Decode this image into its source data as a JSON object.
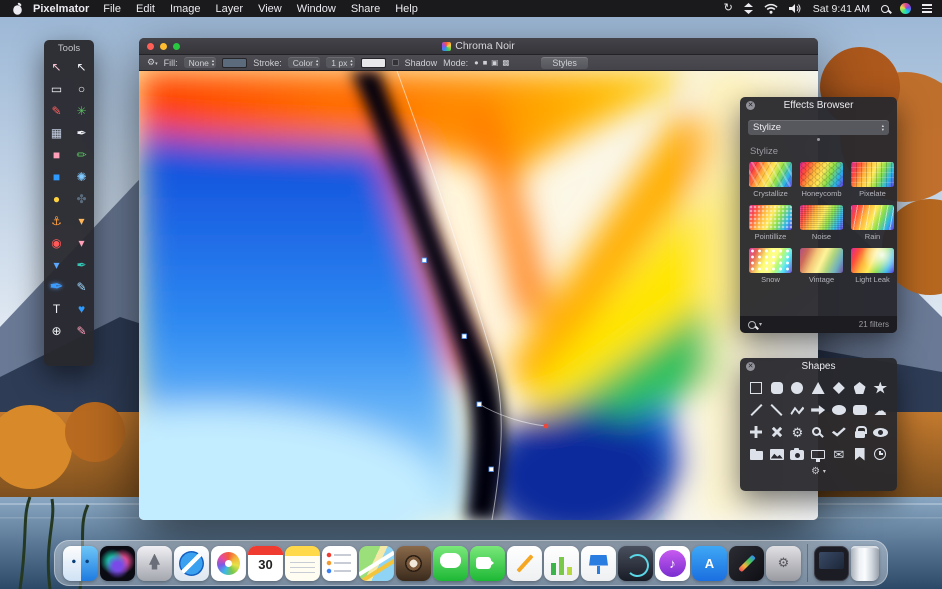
{
  "menu_bar": {
    "app_name": "Pixelmator",
    "menus": [
      "File",
      "Edit",
      "Image",
      "Layer",
      "View",
      "Window",
      "Share",
      "Help"
    ],
    "clock": "Sat 9:41 AM"
  },
  "tools_panel": {
    "title": "Tools",
    "selected_index": 20,
    "tools": [
      {
        "name": "move-tool",
        "glyph": "↖",
        "color": "#f6c3d0"
      },
      {
        "name": "pointer-tool",
        "glyph": "↖",
        "color": "#eef1f6"
      },
      {
        "name": "rect-marquee-tool",
        "glyph": "▭",
        "color": "#eef1f6"
      },
      {
        "name": "ellipse-marquee-tool",
        "glyph": "○",
        "color": "#eef1f6"
      },
      {
        "name": "lasso-pen-tool",
        "glyph": "✎",
        "color": "#ff6161"
      },
      {
        "name": "magic-wand-tool",
        "glyph": "✳",
        "color": "#58c05e"
      },
      {
        "name": "crop-tool",
        "glyph": "▦",
        "color": "#c3cde0"
      },
      {
        "name": "pen-tool",
        "glyph": "✒",
        "color": "#eef1f6"
      },
      {
        "name": "eraser-tool",
        "glyph": "■",
        "color": "#ff9fb8"
      },
      {
        "name": "pencil-tool",
        "glyph": "✏",
        "color": "#58c05e"
      },
      {
        "name": "color-swatch-tool",
        "glyph": "■",
        "color": "#2f9bff"
      },
      {
        "name": "splat-tool",
        "glyph": "✺",
        "color": "#7fc9ff"
      },
      {
        "name": "bucket-tool",
        "glyph": "●",
        "color": "#ffd23e"
      },
      {
        "name": "leaf-tool",
        "glyph": "✤",
        "color": "#5a6b7d"
      },
      {
        "name": "anchor-tool",
        "glyph": "⚓",
        "color": "#ff9d3e"
      },
      {
        "name": "blur-droplet-tool",
        "glyph": "▾",
        "color": "#ffb65a"
      },
      {
        "name": "red-eye-tool",
        "glyph": "◉",
        "color": "#ff5a5a"
      },
      {
        "name": "sponge-droplet-tool",
        "glyph": "▾",
        "color": "#ff9fb8"
      },
      {
        "name": "water-droplet-tool",
        "glyph": "▾",
        "color": "#5aa8ff"
      },
      {
        "name": "teal-pen-tool",
        "glyph": "✒",
        "color": "#35c4b5"
      },
      {
        "name": "paint-pen-tool",
        "glyph": "✒",
        "color": "#3b9cff"
      },
      {
        "name": "light-pen-tool",
        "glyph": "✎",
        "color": "#9fd8ff"
      },
      {
        "name": "type-tool",
        "glyph": "T",
        "color": "#eef1f6"
      },
      {
        "name": "heart-shape-tool",
        "glyph": "♥",
        "color": "#2f9bff"
      },
      {
        "name": "zoom-tool",
        "glyph": "⊕",
        "color": "#eef1f6"
      },
      {
        "name": "pink-pen-tool",
        "glyph": "✎",
        "color": "#ff9fb8"
      }
    ]
  },
  "document_window": {
    "title": "Chroma Noir",
    "toolbar": {
      "fill_label": "Fill:",
      "fill_value": "None",
      "stroke_label": "Stroke:",
      "stroke_value": "Color",
      "stroke_width": "1 px",
      "shadow_label": "Shadow",
      "mode_label": "Mode:",
      "styles_label": "Styles",
      "fill_swatch_color": "#5c6b7c",
      "stroke_swatch_color": "#e8e8ea",
      "mode_icons": [
        {
          "name": "mode-circle-icon",
          "glyph": "●"
        },
        {
          "name": "mode-square-icon",
          "glyph": "■"
        },
        {
          "name": "mode-layers-icon",
          "glyph": "▣"
        },
        {
          "name": "mode-grid-icon",
          "glyph": "▩"
        }
      ]
    }
  },
  "effects_browser": {
    "title": "Effects Browser",
    "category_value": "Stylize",
    "section_label": "Stylize",
    "filter_count": "21 filters",
    "effects": [
      {
        "name": "Crystallize",
        "cls": "fx-crystallize"
      },
      {
        "name": "Honeycomb",
        "cls": "fx-honeycomb"
      },
      {
        "name": "Pixelate",
        "cls": "fx-pixelate"
      },
      {
        "name": "Pointillize",
        "cls": "fx-pointillize"
      },
      {
        "name": "Noise",
        "cls": "fx-noise"
      },
      {
        "name": "Rain",
        "cls": "fx-rain"
      },
      {
        "name": "Snow",
        "cls": "fx-snow"
      },
      {
        "name": "Vintage",
        "cls": "fx-vintage"
      },
      {
        "name": "Light Leak",
        "cls": "fx-lightleak"
      }
    ]
  },
  "shapes_panel": {
    "title": "Shapes",
    "shapes": [
      {
        "name": "square-shape",
        "cls": "shp-square"
      },
      {
        "name": "rounded-square-shape",
        "cls": "shp-rsquare"
      },
      {
        "name": "circle-shape",
        "cls": "shp-circle"
      },
      {
        "name": "triangle-shape",
        "cls": "shp-triangle"
      },
      {
        "name": "diamond-shape",
        "cls": "shp-diamond"
      },
      {
        "name": "pentagon-shape",
        "cls": "shp-pentagon"
      },
      {
        "name": "star-shape",
        "cls": "shp-star"
      },
      {
        "name": "line-shape",
        "cls": "shp-line1"
      },
      {
        "name": "diagonal-line-shape",
        "cls": "shp-line2"
      },
      {
        "name": "zigzag-line-shape",
        "cls": "shp-zigzag"
      },
      {
        "name": "arrow-shape",
        "cls": "shp-arrow"
      },
      {
        "name": "oval-bubble-shape",
        "cls": "shp-bubble-round"
      },
      {
        "name": "rect-bubble-shape",
        "cls": "shp-bubble-rect"
      },
      {
        "name": "cloud-shape",
        "glyph": "☁"
      },
      {
        "name": "plus-shape",
        "cls": "shp-plus"
      },
      {
        "name": "cross-shape",
        "cls": "shp-cross"
      },
      {
        "name": "gear-shape",
        "glyph": "⚙"
      },
      {
        "name": "magnifier-shape",
        "cls": "shp-magnifier"
      },
      {
        "name": "checkmark-shape",
        "cls": "shp-check"
      },
      {
        "name": "lock-shape",
        "cls": "shp-lock"
      },
      {
        "name": "eye-shape",
        "cls": "shp-eye"
      },
      {
        "name": "folder-shape",
        "cls": "shp-folder"
      },
      {
        "name": "picture-shape",
        "cls": "shp-picture"
      },
      {
        "name": "camera-shape",
        "cls": "shp-camera"
      },
      {
        "name": "display-shape",
        "cls": "shp-display"
      },
      {
        "name": "envelope-shape",
        "glyph": "✉"
      },
      {
        "name": "bookmark-shape",
        "cls": "shp-bookmark"
      },
      {
        "name": "clock-shape",
        "cls": "shp-clock"
      }
    ]
  },
  "dock": {
    "items": [
      {
        "type": "app",
        "name": "finder-dock-icon",
        "cls": "ic-finder"
      },
      {
        "type": "app",
        "name": "siri-dock-icon",
        "cls": "ic-siri"
      },
      {
        "type": "app",
        "name": "launchpad-dock-icon",
        "cls": "ic-launchpad"
      },
      {
        "type": "app",
        "name": "safari-dock-icon",
        "cls": "ic-safari"
      },
      {
        "type": "app",
        "name": "photos-dock-icon",
        "cls": "ic-photos"
      },
      {
        "type": "app",
        "name": "calendar-dock-icon",
        "cls": "ic-calendar",
        "day": "30"
      },
      {
        "type": "app",
        "name": "notes-dock-icon",
        "cls": "ic-notes"
      },
      {
        "type": "app",
        "name": "reminders-dock-icon",
        "cls": "ic-reminders"
      },
      {
        "type": "app",
        "name": "maps-dock-icon",
        "cls": "ic-maps"
      },
      {
        "type": "app",
        "name": "photo-booth-dock-icon",
        "cls": "ic-photobooth"
      },
      {
        "type": "app",
        "name": "messages-dock-icon",
        "cls": "ic-messages"
      },
      {
        "type": "app",
        "name": "facetime-dock-icon",
        "cls": "ic-facetime"
      },
      {
        "type": "app",
        "name": "pages-dock-icon",
        "cls": "ic-pages"
      },
      {
        "type": "app",
        "name": "numbers-dock-icon",
        "cls": "ic-numbers"
      },
      {
        "type": "app",
        "name": "keynote-dock-icon",
        "cls": "ic-keynote"
      },
      {
        "type": "app",
        "name": "time-machine-dock-icon",
        "cls": "ic-timemachine"
      },
      {
        "type": "app",
        "name": "itunes-dock-icon",
        "cls": "ic-itunes",
        "glyph": "♪"
      },
      {
        "type": "app",
        "name": "app-store-dock-icon",
        "cls": "ic-appstore",
        "glyph": "A"
      },
      {
        "type": "app",
        "name": "pixelmator-dock-icon",
        "cls": "ic-pixelmator"
      },
      {
        "type": "app",
        "name": "system-preferences-dock-icon",
        "cls": "ic-sysprefs",
        "glyph": "⚙",
        "glyph_color": "#55555c"
      },
      {
        "type": "separator",
        "name": "dock-separator"
      },
      {
        "type": "app",
        "name": "external-display-dock-icon",
        "cls": "ic-display"
      },
      {
        "type": "app",
        "name": "trash-dock-icon",
        "cls": "ic-trash"
      }
    ]
  }
}
